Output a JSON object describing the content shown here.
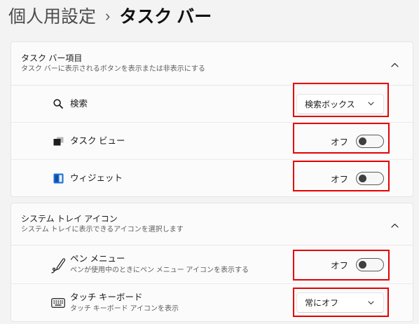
{
  "breadcrumb": {
    "parent": "個人用設定",
    "separator": "›",
    "current": "タスク バー"
  },
  "sections": [
    {
      "title": "タスク バー項目",
      "subtitle": "タスク バーに表示されるボタンを表示または非表示にする",
      "expanded": true,
      "expander_icon": "chevron-up-icon",
      "items": [
        {
          "label": "検索",
          "icon": "search-icon",
          "dropdown": {
            "value": "検索ボックス",
            "icon": "chevron-down-icon"
          }
        },
        {
          "label": "タスク ビュー",
          "icon": "task-view-icon",
          "toggle": {
            "state_label": "オフ",
            "on": false
          }
        },
        {
          "label": "ウィジェット",
          "icon": "widgets-icon",
          "toggle": {
            "state_label": "オフ",
            "on": false
          }
        }
      ]
    },
    {
      "title": "システム トレイ アイコン",
      "subtitle": "システム トレイに表示できるアイコンを選択します",
      "expanded": true,
      "expander_icon": "chevron-up-icon",
      "items": [
        {
          "label": "ペン メニュー",
          "description": "ペンが使用中のときにペン メニュー アイコンを表示する",
          "icon": "pen-icon",
          "toggle": {
            "state_label": "オフ",
            "on": false
          }
        },
        {
          "label": "タッチ キーボード",
          "description": "タッチ キーボード アイコンを表示",
          "icon": "touch-keyboard-icon",
          "dropdown": {
            "value": "常にオフ",
            "icon": "chevron-down-icon"
          }
        }
      ]
    }
  ],
  "colors": {
    "background": "#f3f3f3",
    "card": "#fbfbfb",
    "annotation": "#e60000",
    "widgets_icon": "#1a6fd6"
  }
}
